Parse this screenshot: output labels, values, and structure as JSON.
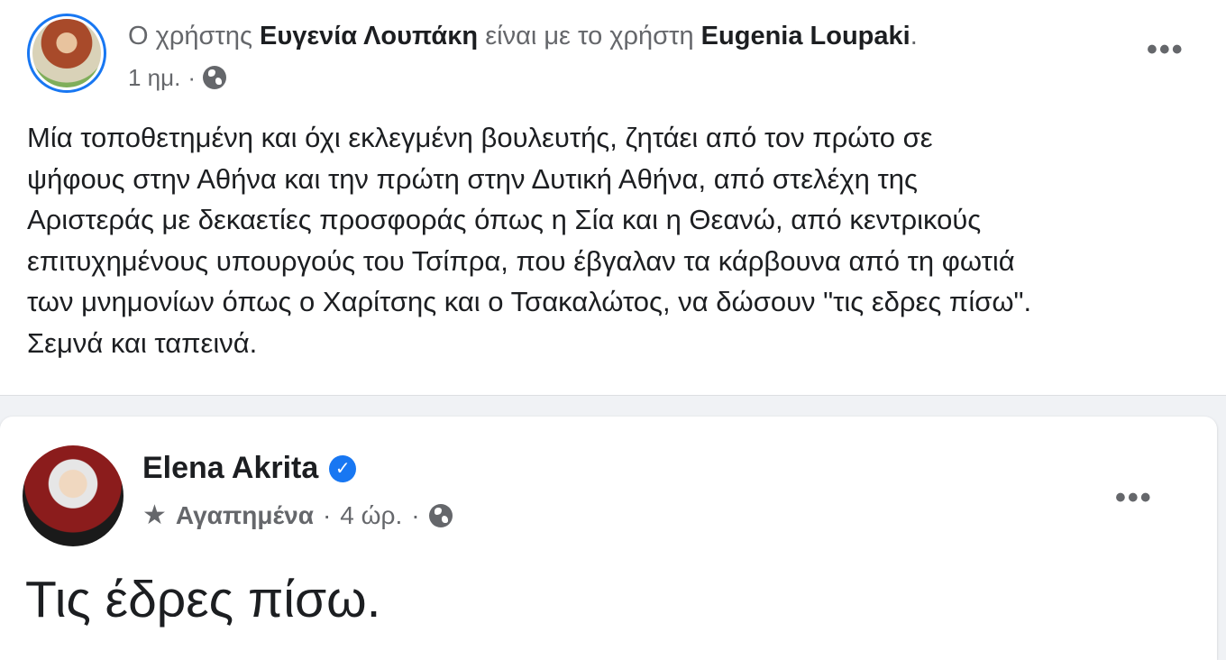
{
  "post1": {
    "header_prefix": "Ο χρήστης",
    "author": "Ευγενία Λουπάκη",
    "header_middle": "είναι με το χρήστη",
    "tagged_user": "Eugenia Loupaki",
    "header_suffix": ".",
    "time": "1 ημ.",
    "separator": "·",
    "more_label": "•••",
    "body_lines": [
      "Μία τοποθετημένη και όχι εκλεγμένη βουλευτής, ζητάει από τον πρώτο σε",
      "ψήφους στην Αθήνα και την πρώτη στην Δυτική Αθήνα, από στελέχη της",
      "Αριστεράς με δεκαετίες προσφοράς όπως η Σία και η Θεανώ, από κεντρικούς",
      "επιτυχημένους υπουργούς του Τσίπρα, που έβγαλαν τα κάρβουνα από τη φωτιά",
      "των μνημονίων όπως ο Χαρίτσης και ο Τσακαλώτος, να δώσουν \"τις εδρες πίσω\".",
      "Σεμνά και ταπεινά."
    ]
  },
  "post2": {
    "author": "Elena Akrita",
    "verified_mark": "✓",
    "star": "★",
    "favorites": "Αγαπημένα",
    "separator": "·",
    "time": "4 ώρ.",
    "more_label": "•••",
    "text": "Τις έδρες πίσω."
  },
  "colors": {
    "accent": "#1877f2",
    "secondary_text": "#65676b",
    "primary_text": "#1c1e21",
    "feed_background": "#f0f2f5"
  }
}
